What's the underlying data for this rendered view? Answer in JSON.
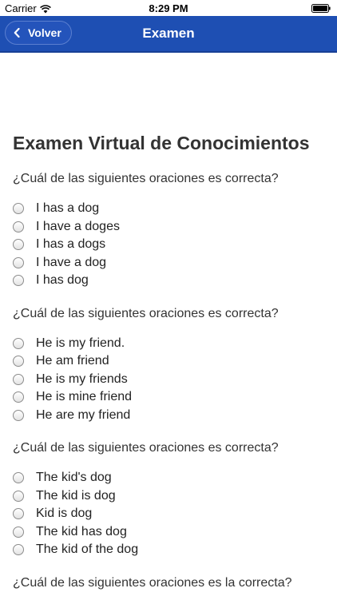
{
  "status_bar": {
    "carrier": "Carrier",
    "time": "8:29 PM",
    "wifi_icon": "wifi-icon",
    "battery_icon": "battery-icon"
  },
  "nav": {
    "back_label": "Volver",
    "title": "Examen",
    "bar_color": "#1e4fb3"
  },
  "content": {
    "title": "Examen Virtual de Conocimientos",
    "questions": [
      {
        "text": "¿Cuál de las siguientes oraciones es correcta?",
        "options": [
          "I has a dog",
          "I have a doges",
          "I has a dogs",
          "I have a dog",
          "I has dog"
        ]
      },
      {
        "text": "¿Cuál de las siguientes oraciones es correcta?",
        "options": [
          "He is my friend.",
          "He am friend",
          "He is my friends",
          "He is mine friend",
          "He are my friend"
        ]
      },
      {
        "text": "¿Cuál de las siguientes oraciones es correcta?",
        "options": [
          "The kid's dog",
          "The kid is dog",
          "Kid is dog",
          "The kid has dog",
          "The kid of the dog"
        ]
      },
      {
        "text": "¿Cuál de las siguientes oraciones es la correcta?",
        "options": []
      }
    ]
  }
}
